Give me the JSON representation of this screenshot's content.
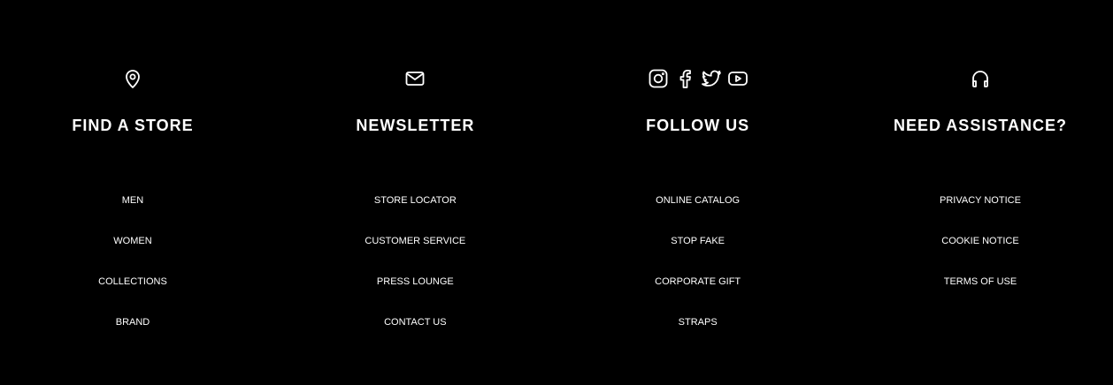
{
  "colors": {
    "background": "#000000",
    "text": "#ffffff"
  },
  "columns": [
    {
      "icons": [
        "location-pin-icon"
      ],
      "title": "FIND A STORE",
      "links": [
        "MEN",
        "WOMEN",
        "COLLECTIONS",
        "BRAND"
      ]
    },
    {
      "icons": [
        "envelope-icon"
      ],
      "title": "NEWSLETTER",
      "links": [
        "STORE LOCATOR",
        "CUSTOMER SERVICE",
        "PRESS LOUNGE",
        "CONTACT US"
      ]
    },
    {
      "icons": [
        "instagram-icon",
        "facebook-icon",
        "twitter-icon",
        "youtube-icon"
      ],
      "title": "FOLLOW US",
      "links": [
        "ONLINE CATALOG",
        "STOP FAKE",
        "CORPORATE GIFT",
        "STRAPS"
      ]
    },
    {
      "icons": [
        "headphones-icon"
      ],
      "title": "NEED ASSISTANCE?",
      "links": [
        "PRIVACY NOTICE",
        "COOKIE NOTICE",
        "TERMS OF USE"
      ]
    }
  ]
}
